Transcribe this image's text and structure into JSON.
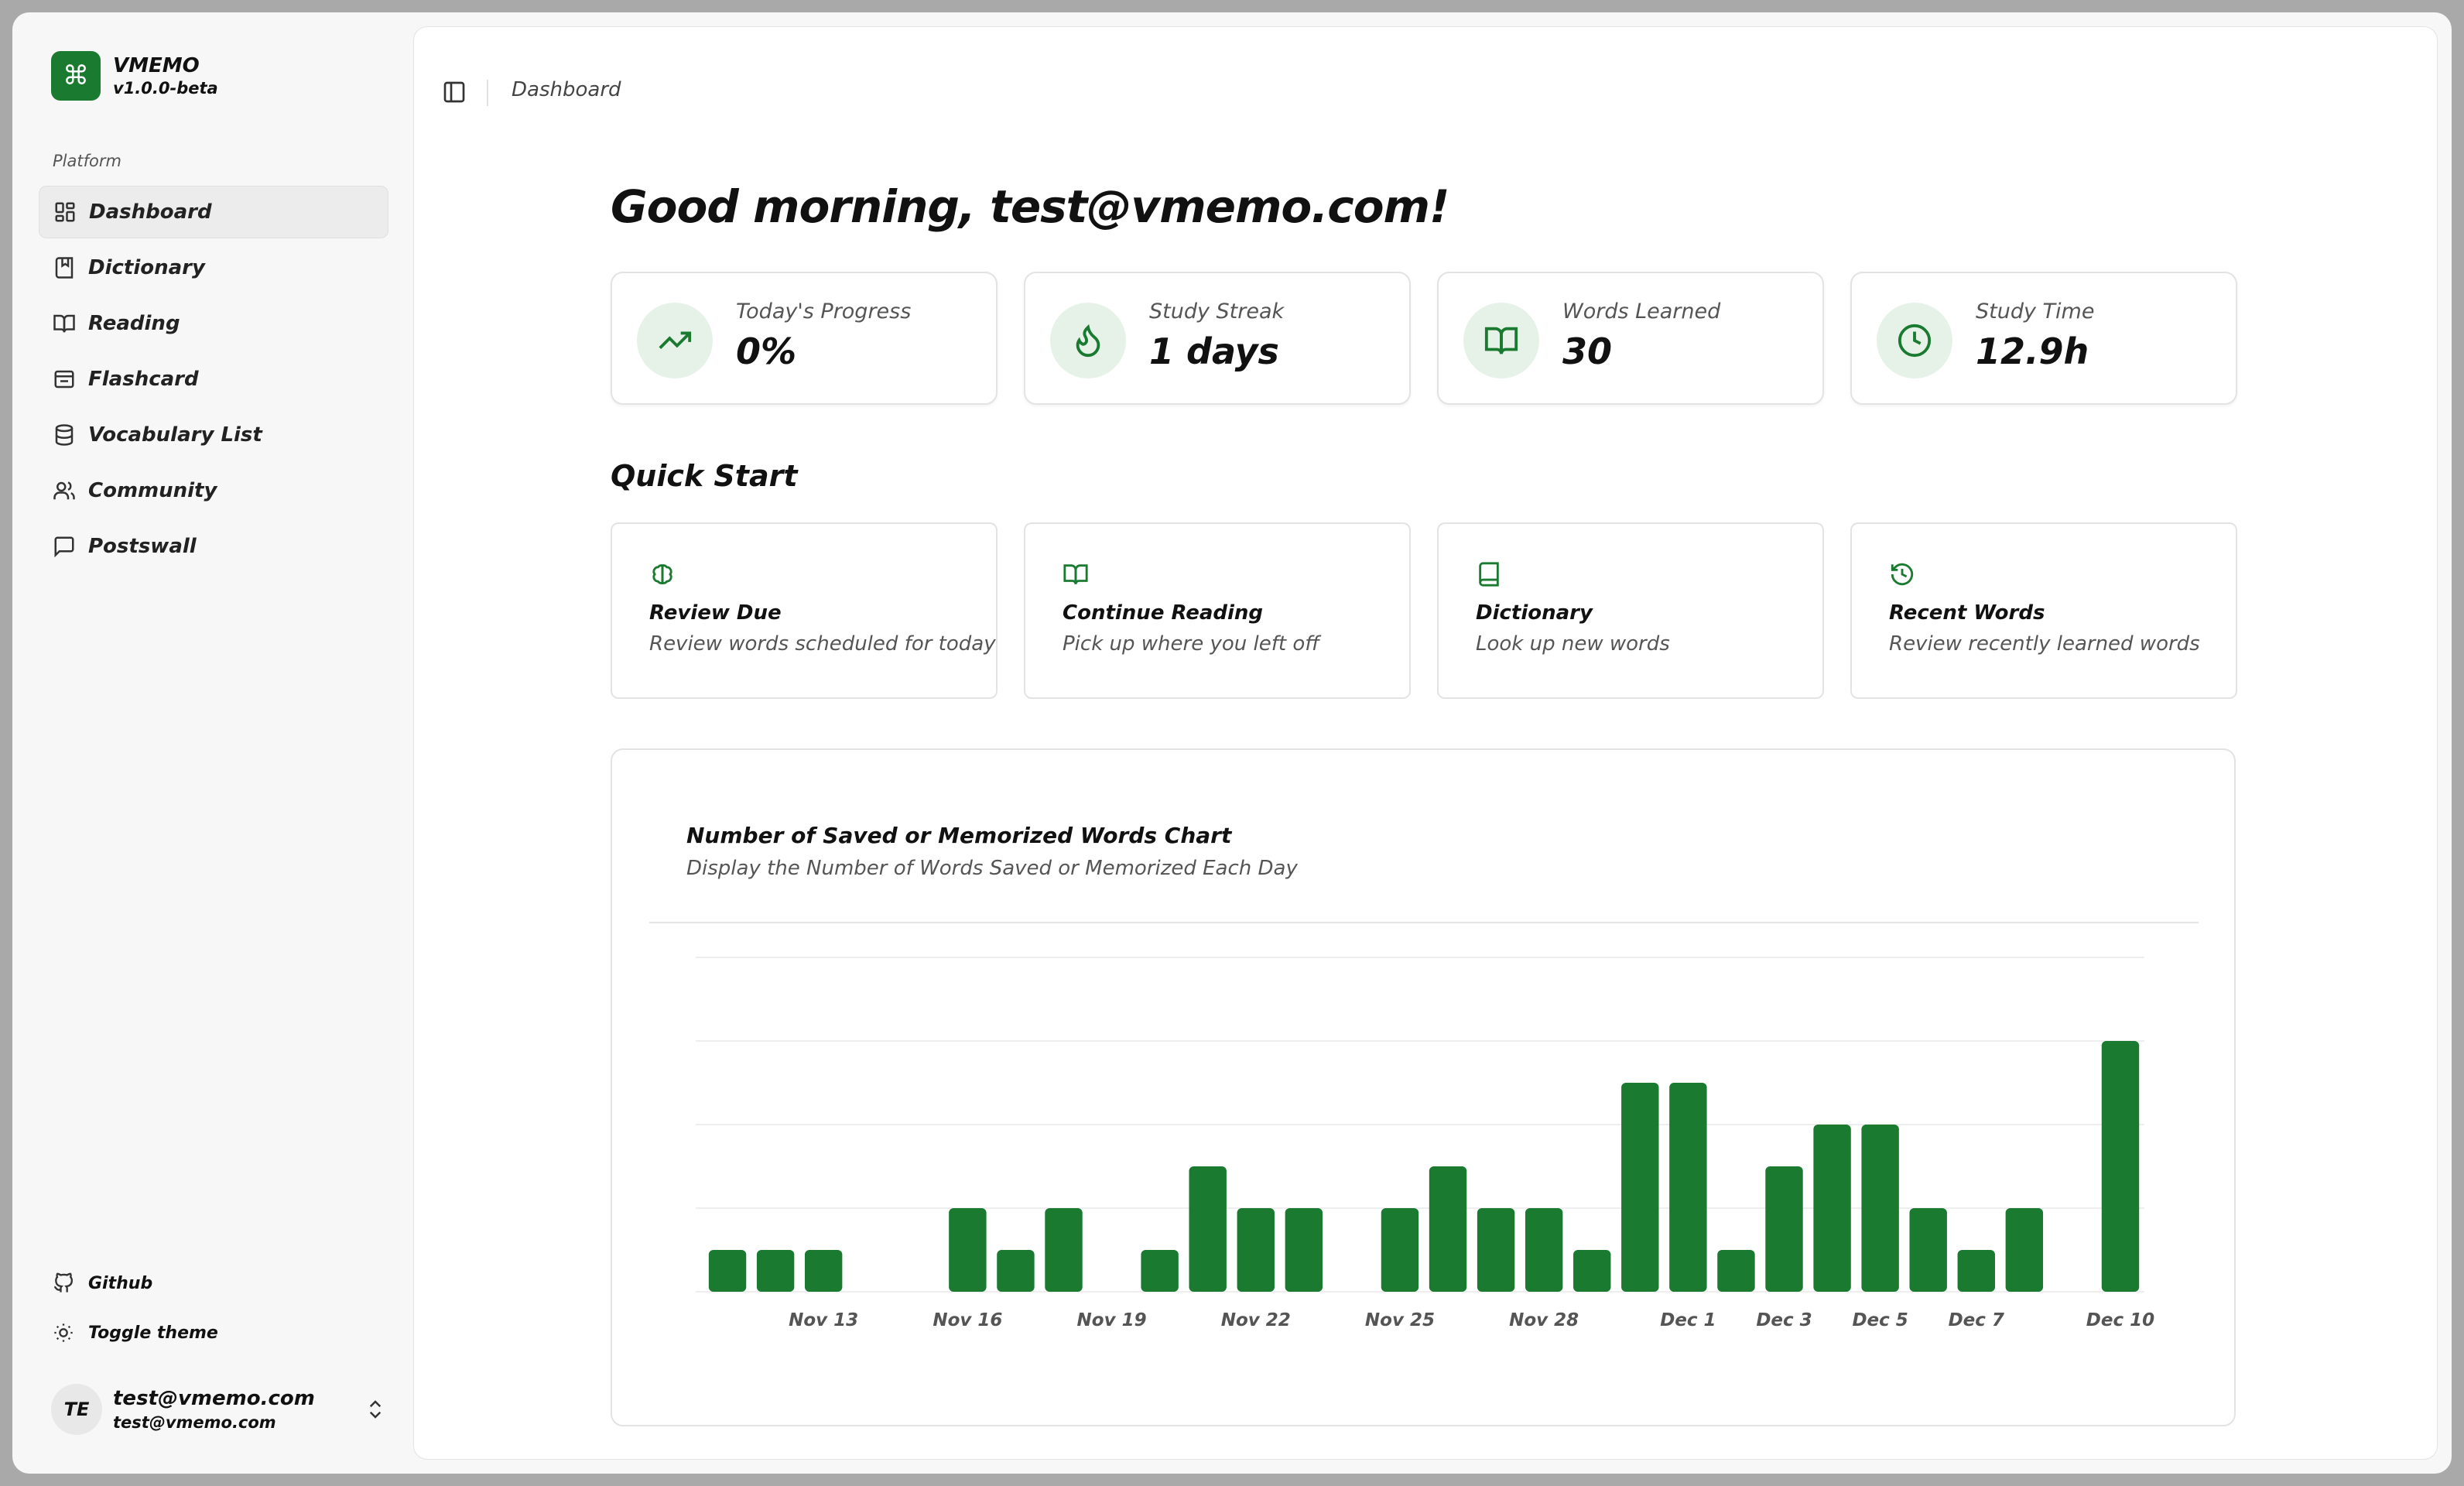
{
  "brand": {
    "name": "VMEMO",
    "version": "v1.0.0-beta",
    "logo_glyph": "⌘",
    "accent": "#197a30"
  },
  "sidebar": {
    "section_label": "Platform",
    "items": [
      {
        "label": "Dashboard",
        "icon": "dashboard-icon",
        "active": true
      },
      {
        "label": "Dictionary",
        "icon": "book-bookmark-icon"
      },
      {
        "label": "Reading",
        "icon": "book-open-icon"
      },
      {
        "label": "Flashcard",
        "icon": "flashcard-icon"
      },
      {
        "label": "Vocabulary List",
        "icon": "database-icon"
      },
      {
        "label": "Community",
        "icon": "users-icon"
      },
      {
        "label": "Postswall",
        "icon": "message-icon"
      }
    ],
    "footer": {
      "github": "Github",
      "toggle_theme": "Toggle theme"
    },
    "user": {
      "initials": "TE",
      "name": "test@vmemo.com",
      "email": "test@vmemo.com"
    }
  },
  "header": {
    "breadcrumb": "Dashboard"
  },
  "main": {
    "greeting": "Good morning, test@vmemo.com!",
    "stats": [
      {
        "label": "Today's Progress",
        "value": "0%",
        "icon": "trending-up-icon"
      },
      {
        "label": "Study Streak",
        "value": "1 days",
        "icon": "flame-icon"
      },
      {
        "label": "Words Learned",
        "value": "30",
        "icon": "book-open-icon"
      },
      {
        "label": "Study Time",
        "value": "12.9h",
        "icon": "clock-icon"
      }
    ],
    "quick_start": {
      "title": "Quick Start",
      "cards": [
        {
          "title": "Review Due",
          "desc": "Review words scheduled for today",
          "icon": "brain-icon"
        },
        {
          "title": "Continue Reading",
          "desc": "Pick up where you left off",
          "icon": "book-open-icon"
        },
        {
          "title": "Dictionary",
          "desc": "Look up new words",
          "icon": "book-icon"
        },
        {
          "title": "Recent Words",
          "desc": "Review recently learned words",
          "icon": "history-icon"
        }
      ]
    }
  },
  "chart_data": {
    "type": "bar",
    "title": "Number of Saved or Memorized Words Chart",
    "subtitle": "Display the Number of Words Saved or Memorized Each Day",
    "categories": [
      "Nov 11",
      "Nov 12",
      "Nov 13",
      "Nov 14",
      "Nov 15",
      "Nov 16",
      "Nov 17",
      "Nov 18",
      "Nov 19",
      "Nov 20",
      "Nov 21",
      "Nov 22",
      "Nov 23",
      "Nov 24",
      "Nov 25",
      "Nov 26",
      "Nov 27",
      "Nov 28",
      "Nov 29",
      "Nov 30",
      "Dec 1",
      "Dec 2",
      "Dec 3",
      "Dec 4",
      "Dec 5",
      "Dec 6",
      "Dec 7",
      "Dec 8",
      "Dec 9",
      "Dec 10"
    ],
    "values": [
      1,
      1,
      1,
      0,
      0,
      2,
      1,
      2,
      0,
      1,
      3,
      2,
      2,
      0,
      2,
      3,
      2,
      2,
      1,
      5,
      5,
      1,
      3,
      4,
      4,
      2,
      1,
      2,
      0,
      6
    ],
    "tick_labels": [
      "Nov 13",
      "Nov 16",
      "Nov 19",
      "Nov 22",
      "Nov 25",
      "Nov 28",
      "Dec 1",
      "Dec 3",
      "Dec 5",
      "Dec 7",
      "Dec 10"
    ],
    "ylim": [
      0,
      8
    ],
    "grid": "horizontal",
    "bar_color": "#197a30"
  }
}
